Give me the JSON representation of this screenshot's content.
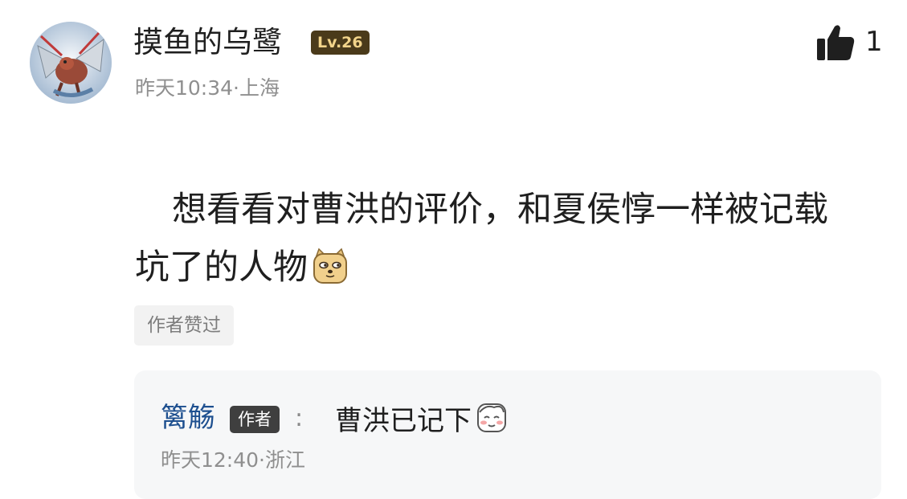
{
  "post": {
    "username": "摸鱼的乌鹭",
    "level": "Lv.26",
    "time": "昨天10:34",
    "location": "上海",
    "like_count": "1",
    "text_line1": "想看看对曹洪的评价，和夏侯惇一样被记载",
    "text_line2": "坑了的人物",
    "emoji_icon": "doge-emoji",
    "author_liked_label": "作者赞过"
  },
  "reply": {
    "author": "篱觞",
    "author_badge": "作者",
    "colon": ":",
    "text": "曹洪已记下",
    "emoji_icon": "shy-emoji",
    "time": "昨天12:40",
    "location": "浙江"
  },
  "colors": {
    "level_badge_bg": "#4a3a1a",
    "level_badge_text": "#f2d48a",
    "reply_name": "#1d4f8f",
    "meta_gray": "#8f8f8f",
    "reply_box_bg": "#f6f7f8"
  }
}
